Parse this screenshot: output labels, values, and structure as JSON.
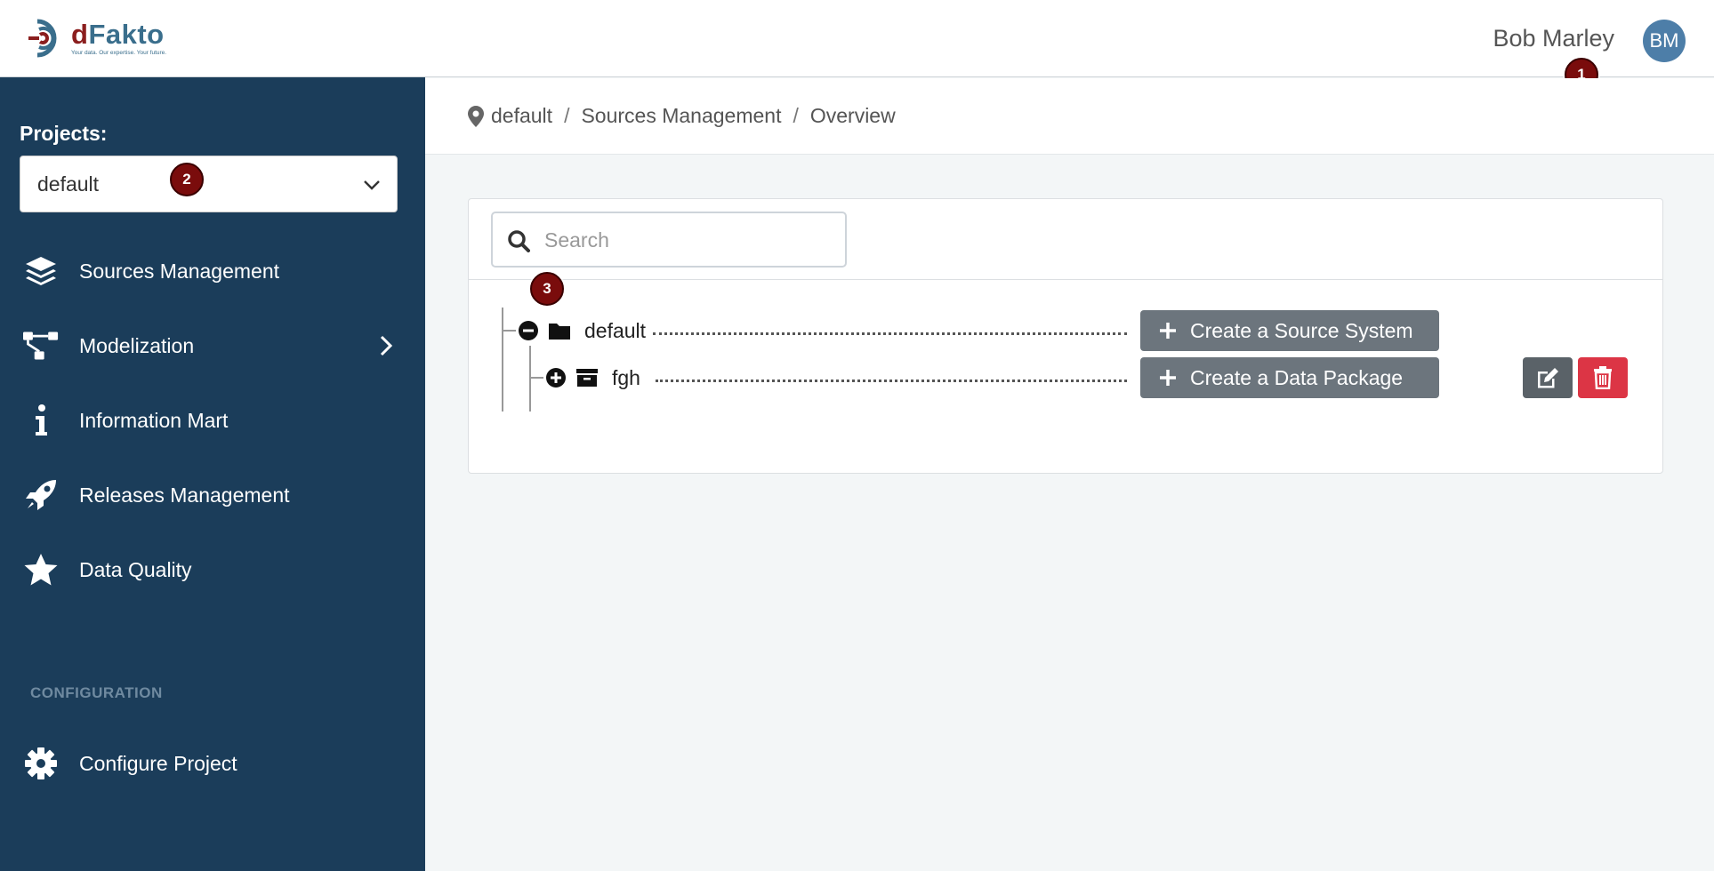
{
  "header": {
    "brand_d": "d",
    "brand_rest": "Fakto",
    "tagline": "Your data. Our expertise. Your future.",
    "user_name": "Bob Marley",
    "avatar_initials": "BM"
  },
  "markers": {
    "m1": "1",
    "m2": "2",
    "m3": "3"
  },
  "sidebar": {
    "projects_label": "Projects:",
    "project_selected": "default",
    "items": [
      {
        "label": "Sources Management",
        "icon": "layers-icon"
      },
      {
        "label": "Modelization",
        "icon": "sitemap-icon"
      },
      {
        "label": "Information Mart",
        "icon": "info-icon"
      },
      {
        "label": "Releases Management",
        "icon": "rocket-icon"
      },
      {
        "label": "Data Quality",
        "icon": "star-icon"
      }
    ],
    "config_section": "CONFIGURATION",
    "config_items": [
      {
        "label": "Configure Project",
        "icon": "gear-icon"
      }
    ]
  },
  "breadcrumb": [
    "default",
    "Sources Management",
    "Overview"
  ],
  "search": {
    "placeholder": "Search",
    "value": ""
  },
  "tree": {
    "root": {
      "label": "default",
      "action": "Create a Source System"
    },
    "child": {
      "label": "fgh",
      "action": "Create a Data Package"
    }
  },
  "colors": {
    "sidebar_bg": "#1b3d5a",
    "avatar_bg": "#4d7ea8",
    "marker_bg": "#7a0c0c",
    "button_gray": "#6c757d",
    "delete_red": "#dc3545",
    "edit_gray": "#5a6268"
  }
}
